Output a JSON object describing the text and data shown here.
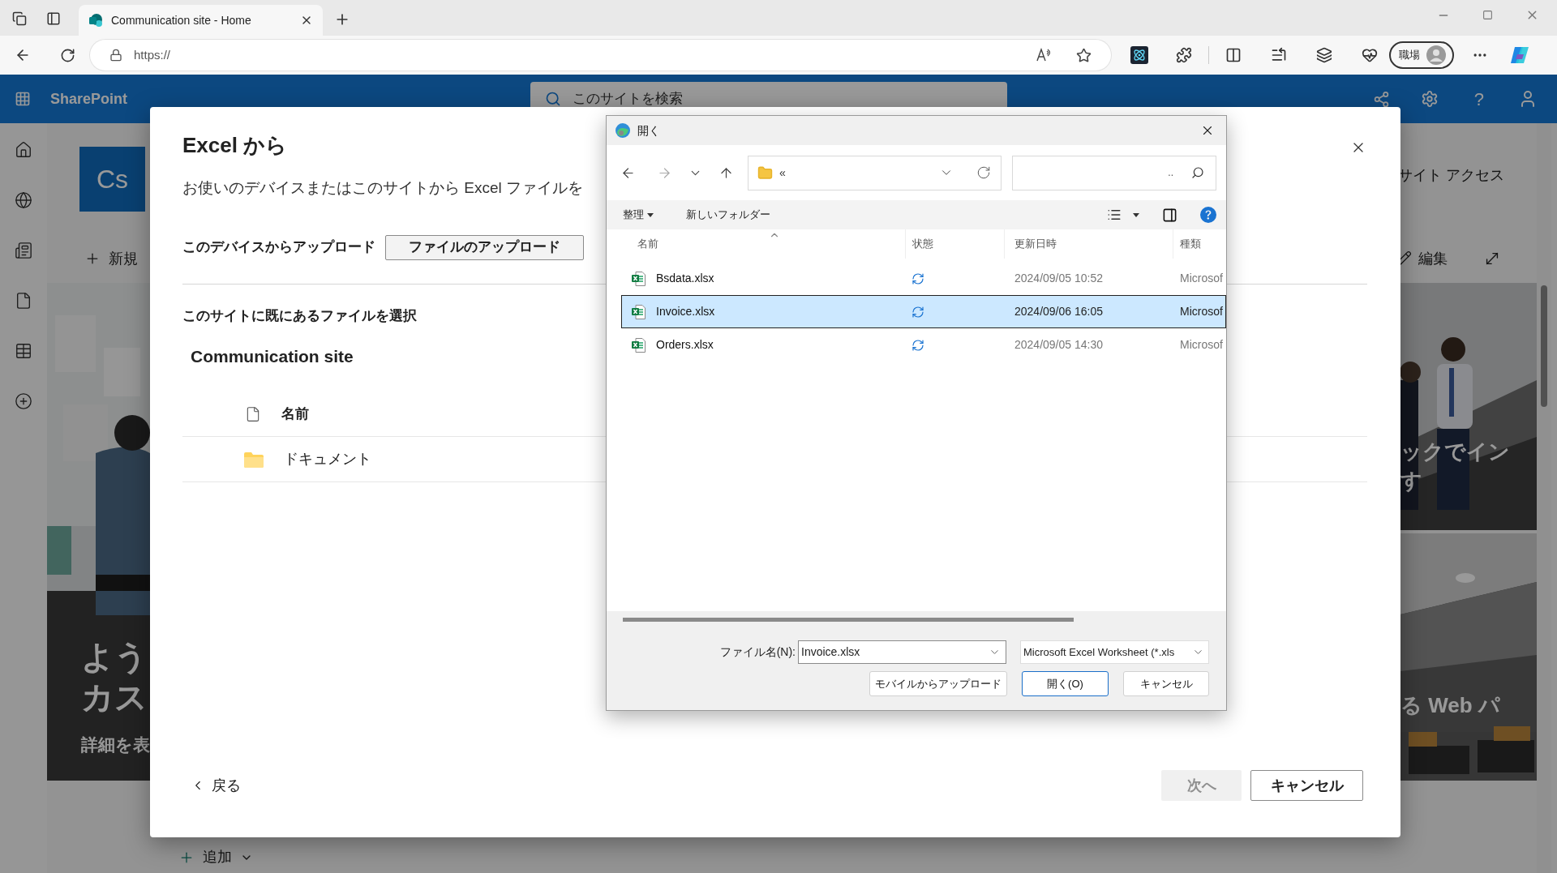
{
  "browser": {
    "tabs": [
      {
        "title": "Communication site - Home",
        "selected": true
      }
    ],
    "address": "https://",
    "profile_label": "職場"
  },
  "suite_bar": {
    "app_name": "SharePoint",
    "search_placeholder": "このサイトを検索",
    "help": "?"
  },
  "site": {
    "logo_text": "Cs",
    "new_button": "新規",
    "site_access": "サイト アクセス",
    "edit_button": "編集",
    "hero_lines": [
      "よう",
      "カス"
    ],
    "hero_link": "詳細を表",
    "tiles": [
      {
        "lines": [
          "ックでイン",
          "す"
        ]
      },
      {
        "lines": [
          "る Web パ"
        ]
      }
    ],
    "add_button": "追加"
  },
  "modal": {
    "title": "Excel から",
    "description": "お使いのデバイスまたはこのサイトから Excel ファイルを",
    "upload_label": "このデバイスからアップロード",
    "upload_button": "ファイルのアップロード",
    "existing_label": "このサイトに既にあるファイルを選択",
    "site_name": "Communication site",
    "list_header": "名前",
    "items": [
      {
        "name": "ドキュメント",
        "kind": "folder"
      }
    ],
    "back": "戻る",
    "next_button": {
      "label": "次へ",
      "disabled": true
    },
    "cancel": "キャンセル"
  },
  "open_dialog": {
    "title": "開く",
    "nav": {
      "forward_disabled": true
    },
    "path": "«",
    "search_text": "..",
    "toolbar": {
      "organize": "整理",
      "new_folder": "新しいフォルダー"
    },
    "columns": [
      "名前",
      "状態",
      "更新日時",
      "種類"
    ],
    "rows": [
      {
        "name": "Bsdata.xlsx",
        "date": "2024/09/05 10:52",
        "type": "Microsof",
        "selected": false
      },
      {
        "name": "Invoice.xlsx",
        "date": "2024/09/06 16:05",
        "type": "Microsof",
        "selected": true
      },
      {
        "name": "Orders.xlsx",
        "date": "2024/09/05 14:30",
        "type": "Microsof",
        "selected": false
      }
    ],
    "filename_label": "ファイル名(N):",
    "filename": "Invoice.xlsx",
    "filter": "Microsoft Excel Worksheet (*.xls",
    "buttons": [
      {
        "label": "モバイルからアップロード",
        "primary": false
      },
      {
        "label": "開く(O)",
        "primary": true
      },
      {
        "label": "キャンセル",
        "primary": false
      }
    ]
  }
}
